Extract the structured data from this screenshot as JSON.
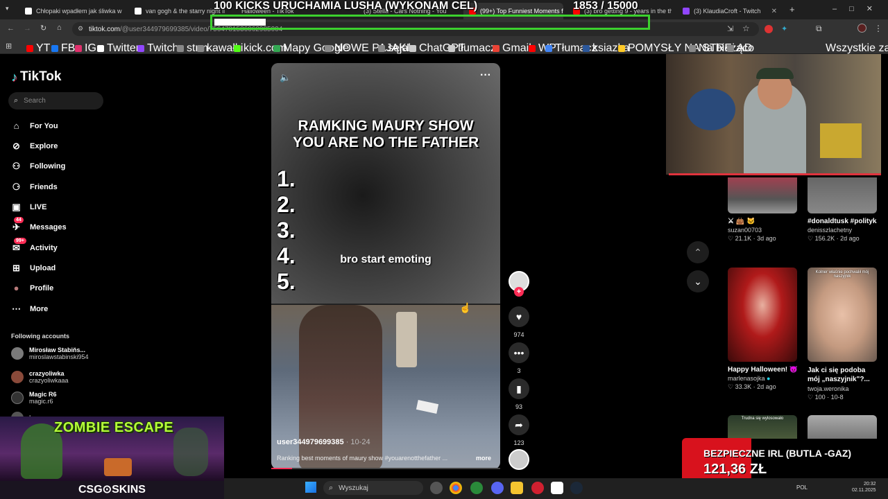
{
  "browser": {
    "tabs": [
      {
        "label": "Chłopaki wpadłem jak śliwka w"
      },
      {
        "label": "van gogh & the starry night II"
      },
      {
        "label": "Halloween - TikTok"
      },
      {
        "label": "(3) Stella - Cars Nothing - You"
      },
      {
        "label": "(99+) Top Funniest Moments fro"
      },
      {
        "label": "(3) bro getting 9 - years in the thi"
      },
      {
        "label": "(3) KlaudiaCroft - Twitch"
      }
    ],
    "new_tab": "+",
    "url_domain": "tiktok.com",
    "url_path": "/@user344979699385/video/7564781536062985004"
  },
  "bookmarks": [
    {
      "label": "YT",
      "color": "#ff0000"
    },
    {
      "label": "FB",
      "color": "#1877f2"
    },
    {
      "label": "IG",
      "color": "#e1306c"
    },
    {
      "label": "Twitter",
      "color": "#ffffff"
    },
    {
      "label": "Twitch",
      "color": "#9146ff"
    },
    {
      "label": "strm",
      "color": "#888888"
    },
    {
      "label": "kawałki",
      "color": "#888888"
    },
    {
      "label": "kick.com",
      "color": "#53fc18"
    },
    {
      "label": "Mapy Google",
      "color": "#34a853"
    },
    {
      "label": "NOWE PAJĄKI",
      "color": "#888888"
    },
    {
      "label": "sejak",
      "color": "#888888"
    },
    {
      "label": "ChatGPT",
      "color": "#cccccc"
    },
    {
      "label": "tłumacz",
      "color": "#cccccc"
    },
    {
      "label": "Gmail",
      "color": "#ea4335"
    },
    {
      "label": "WP",
      "color": "#ff0000"
    },
    {
      "label": "Tłumacz",
      "color": "#4285f4"
    },
    {
      "label": "ksiazka",
      "color": "#2b579a"
    },
    {
      "label": "POMYSŁY NA STRE...",
      "color": "#ffca28"
    },
    {
      "label": "Na bieżąco",
      "color": "#888888"
    },
    {
      "label": "AD",
      "color": "#888888"
    }
  ],
  "bookmarks_all": "Wszystkie zakładki",
  "overlay": {
    "kicks_text": "100 KICKS URUCHAMIA LUSHA (WYKONAM CEL)",
    "goal_text": "1853   / 15000",
    "goal_progress": 0.12
  },
  "sidebar": {
    "logo": "TikTok",
    "search_placeholder": "Search",
    "nav": [
      {
        "label": "For You",
        "icon": "home-icon"
      },
      {
        "label": "Explore",
        "icon": "compass-icon"
      },
      {
        "label": "Following",
        "icon": "following-icon"
      },
      {
        "label": "Friends",
        "icon": "friends-icon"
      },
      {
        "label": "LIVE",
        "icon": "live-icon"
      },
      {
        "label": "Messages",
        "icon": "messages-icon",
        "badge": "44"
      },
      {
        "label": "Activity",
        "icon": "activity-icon",
        "badge": "99+"
      },
      {
        "label": "Upload",
        "icon": "upload-icon"
      },
      {
        "label": "Profile",
        "icon": "profile-icon"
      },
      {
        "label": "More",
        "icon": "more-icon"
      }
    ],
    "following_title": "Following accounts",
    "accounts": [
      {
        "name": "Mirosław Stabiňs...",
        "handle": "miroslawstabinski954"
      },
      {
        "name": "crazyoliwka",
        "handle": "crazyoliwkaaa"
      },
      {
        "name": "Magic R6",
        "handle": "magic.r6"
      },
      {
        "name": "janczan",
        "handle": ""
      }
    ]
  },
  "ad": {
    "title": "ZOMBIE ESCAPE",
    "brand": "CSG⊙SKINS"
  },
  "video": {
    "headline_line1": "RAMKING MAURY SHOW",
    "headline_line2": "YOU ARE NO THE FATHER",
    "ranks": [
      "1.",
      "2.",
      "3.",
      "4.",
      "5."
    ],
    "overlay_caption": "bro start emoting",
    "author": "user344979699385",
    "date": " · 10-24",
    "description": "Ranking best moments of maury show #youarenotthefather ...",
    "more": "more",
    "progress": 0.09
  },
  "actions": {
    "likes": "974",
    "comments": "3",
    "saves": "93",
    "shares": "123"
  },
  "grid": [
    {
      "title": "",
      "user": "suzan00703",
      "likes": "21.1K",
      "age": "3d ago",
      "emoji": "⚔ 👜 🐱"
    },
    {
      "title": "#donaldtusk #polityka...",
      "user": "denisszlachetny",
      "likes": "156.2K",
      "age": "2d ago"
    },
    {
      "title": "Happy Halloween! 😈...",
      "user": "marlenasojka",
      "likes": "33.3K",
      "age": "2d ago"
    },
    {
      "title": "Jak ci się podoba mój „naszyjnik\"?...",
      "user": "twoja.weronika",
      "likes": "100",
      "age": "10-8",
      "thumb_caption": "Kolner właśnie pochwalił mój naszyjnik"
    },
    {
      "title": "",
      "user": "",
      "likes": "",
      "age": "",
      "thumb_caption": "Trudna się wylosowało"
    },
    {
      "title": "",
      "user": "",
      "likes": "",
      "age": ""
    }
  ],
  "donation": {
    "line1": "BEZPIECZNE IRL (BUTLA -GAZ)",
    "line2": "121,36 ZŁ"
  },
  "taskbar": {
    "search": "Wyszukaj",
    "lang": "POL",
    "time": "20:32",
    "date": "02.11.2025"
  }
}
